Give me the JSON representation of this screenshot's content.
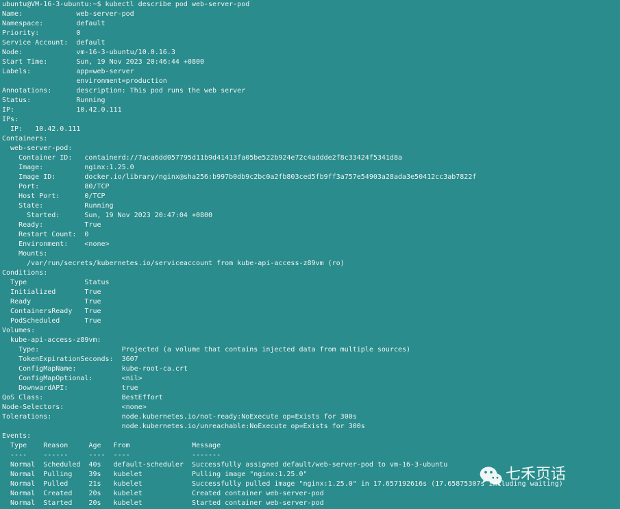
{
  "terminal": {
    "background_color": "#2a8c8c",
    "foreground_color": "#f4f4f4",
    "prompt": "ubuntu@VM-16-3-ubuntu:~$ kubectl describe pod web-server-pod",
    "lines": [
      "ubuntu@VM-16-3-ubuntu:~$ kubectl describe pod web-server-pod",
      "Name:             web-server-pod",
      "Namespace:        default",
      "Priority:         0",
      "Service Account:  default",
      "Node:             vm-16-3-ubuntu/10.0.16.3",
      "Start Time:       Sun, 19 Nov 2023 20:46:44 +0800",
      "Labels:           app=web-server",
      "                  environment=production",
      "Annotations:      description: This pod runs the web server",
      "Status:           Running",
      "IP:               10.42.0.111",
      "IPs:",
      "  IP:   10.42.0.111",
      "Containers:",
      "  web-server-pod:",
      "    Container ID:   containerd://7aca6dd057795d11b9d41413fa05be522b924e72c4addde2f8c33424f5341d8a",
      "    Image:          nginx:1.25.0",
      "    Image ID:       docker.io/library/nginx@sha256:b997b0db9c2bc0a2fb803ced5fb9ff3a757e54903a28ada3e50412cc3ab7822f",
      "    Port:           80/TCP",
      "    Host Port:      0/TCP",
      "    State:          Running",
      "      Started:      Sun, 19 Nov 2023 20:47:04 +0800",
      "    Ready:          True",
      "    Restart Count:  0",
      "    Environment:    <none>",
      "    Mounts:",
      "      /var/run/secrets/kubernetes.io/serviceaccount from kube-api-access-z89vm (ro)",
      "Conditions:",
      "  Type              Status",
      "  Initialized       True",
      "  Ready             True",
      "  ContainersReady   True",
      "  PodScheduled      True",
      "Volumes:",
      "  kube-api-access-z89vm:",
      "    Type:                    Projected (a volume that contains injected data from multiple sources)",
      "    TokenExpirationSeconds:  3607",
      "    ConfigMapName:           kube-root-ca.crt",
      "    ConfigMapOptional:       <nil>",
      "    DownwardAPI:             true",
      "QoS Class:                   BestEffort",
      "Node-Selectors:              <none>",
      "Tolerations:                 node.kubernetes.io/not-ready:NoExecute op=Exists for 300s",
      "                             node.kubernetes.io/unreachable:NoExecute op=Exists for 300s",
      "Events:",
      "  Type    Reason     Age   From               Message",
      "  ----    ------     ----  ----               -------",
      "  Normal  Scheduled  40s   default-scheduler  Successfully assigned default/web-server-pod to vm-16-3-ubuntu",
      "  Normal  Pulling    39s   kubelet            Pulling image \"nginx:1.25.0\"",
      "  Normal  Pulled     21s   kubelet            Successfully pulled image \"nginx:1.25.0\" in 17.657192616s (17.65875307s including waiting)",
      "  Normal  Created    20s   kubelet            Created container web-server-pod",
      "  Normal  Started    20s   kubelet            Started container web-server-pod"
    ]
  },
  "pod": {
    "name": "web-server-pod",
    "namespace": "default",
    "priority": "0",
    "service_account": "default",
    "node": "vm-16-3-ubuntu/10.0.16.3",
    "start_time": "Sun, 19 Nov 2023 20:46:44 +0800",
    "labels": [
      "app=web-server",
      "environment=production"
    ],
    "annotations": "description: This pod runs the web server",
    "status": "Running",
    "ip": "10.42.0.111",
    "ips": [
      "10.42.0.111"
    ],
    "qos_class": "BestEffort",
    "node_selectors": "<none>",
    "tolerations": [
      "node.kubernetes.io/not-ready:NoExecute op=Exists for 300s",
      "node.kubernetes.io/unreachable:NoExecute op=Exists for 300s"
    ]
  },
  "container": {
    "name": "web-server-pod",
    "container_id": "containerd://7aca6dd057795d11b9d41413fa05be522b924e72c4addde2f8c33424f5341d8a",
    "image": "nginx:1.25.0",
    "image_id": "docker.io/library/nginx@sha256:b997b0db9c2bc0a2fb803ced5fb9ff3a757e54903a28ada3e50412cc3ab7822f",
    "port": "80/TCP",
    "host_port": "0/TCP",
    "state": "Running",
    "started": "Sun, 19 Nov 2023 20:47:04 +0800",
    "ready": "True",
    "restart_count": "0",
    "environment": "<none>",
    "mounts": [
      "/var/run/secrets/kubernetes.io/serviceaccount from kube-api-access-z89vm (ro)"
    ]
  },
  "conditions": {
    "headers": [
      "Type",
      "Status"
    ],
    "rows": [
      [
        "Initialized",
        "True"
      ],
      [
        "Ready",
        "True"
      ],
      [
        "ContainersReady",
        "True"
      ],
      [
        "PodScheduled",
        "True"
      ]
    ]
  },
  "volumes": {
    "name": "kube-api-access-z89vm",
    "type": "Projected (a volume that contains injected data from multiple sources)",
    "token_expiration_seconds": "3607",
    "config_map_name": "kube-root-ca.crt",
    "config_map_optional": "<nil>",
    "downward_api": "true"
  },
  "events": {
    "headers": [
      "Type",
      "Reason",
      "Age",
      "From",
      "Message"
    ],
    "rows": [
      [
        "Normal",
        "Scheduled",
        "40s",
        "default-scheduler",
        "Successfully assigned default/web-server-pod to vm-16-3-ubuntu"
      ],
      [
        "Normal",
        "Pulling",
        "39s",
        "kubelet",
        "Pulling image \"nginx:1.25.0\""
      ],
      [
        "Normal",
        "Pulled",
        "21s",
        "kubelet",
        "Successfully pulled image \"nginx:1.25.0\" in 17.657192616s (17.65875307s including waiting)"
      ],
      [
        "Normal",
        "Created",
        "20s",
        "kubelet",
        "Created container web-server-pod"
      ],
      [
        "Normal",
        "Started",
        "20s",
        "kubelet",
        "Started container web-server-pod"
      ]
    ]
  },
  "watermark": {
    "text": "七禾页话",
    "icon": "wechat-icon",
    "color": "#ffffff"
  }
}
